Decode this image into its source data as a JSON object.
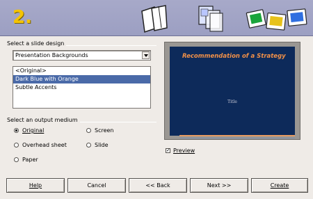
{
  "header": {
    "step": "2.",
    "icons": [
      "pages-stack-icon",
      "layout-pages-icon",
      "slides-icon"
    ]
  },
  "design": {
    "group_title": "Select a slide design",
    "combo_value": "Presentation Backgrounds",
    "list": [
      "<Original>",
      "Dark Blue with Orange",
      "Subtle Accents"
    ],
    "selected_index": 1
  },
  "medium": {
    "group_title": "Select an output medium",
    "options": [
      {
        "label": "Original",
        "checked": true
      },
      {
        "label": "Overhead sheet",
        "checked": false
      },
      {
        "label": "Paper",
        "checked": false
      },
      {
        "label": "Screen",
        "checked": false
      },
      {
        "label": "Slide",
        "checked": false
      }
    ]
  },
  "preview": {
    "slide_title": "Recommendation of a Strategy",
    "slide_subtitle": "Title",
    "checkbox_label": "Preview",
    "checked": true,
    "colors": {
      "background": "#0d2a5a",
      "accent": "#f09048"
    }
  },
  "buttons": {
    "help": "Help",
    "cancel": "Cancel",
    "back": "<< Back",
    "next": "Next >>",
    "create": "Create"
  }
}
